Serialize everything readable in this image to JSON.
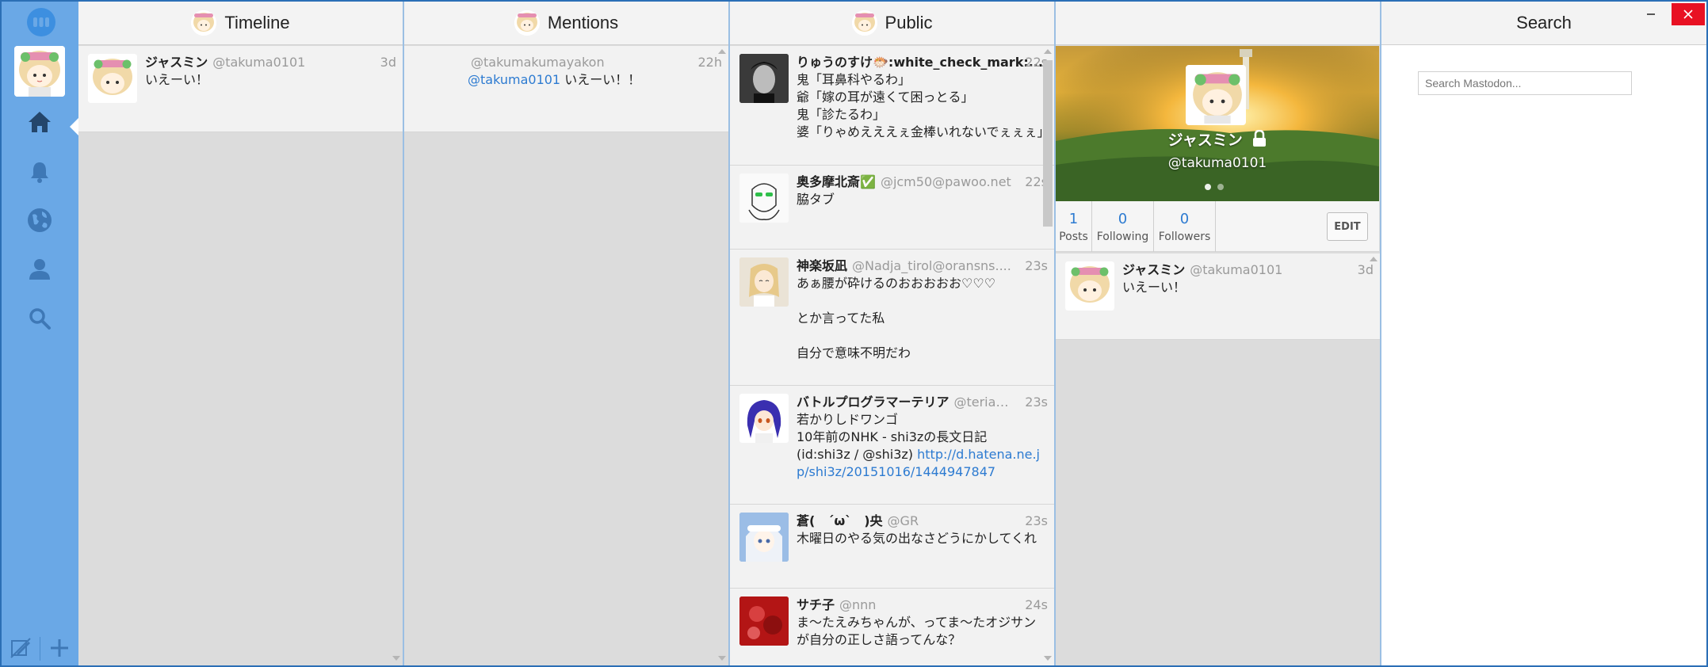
{
  "sidebar": {
    "nav": [
      "home-icon",
      "bell-icon",
      "globe-icon",
      "user-icon",
      "search-icon"
    ],
    "bottom": [
      "edit-icon",
      "plus-icon"
    ]
  },
  "columns": {
    "timeline": {
      "title": "Timeline",
      "toots": [
        {
          "name": "ジャスミン",
          "acct": "@takuma0101",
          "time": "3d",
          "text": "いえーい！"
        }
      ]
    },
    "mentions": {
      "title": "Mentions",
      "toots": [
        {
          "acct": "@takumakumayakon",
          "time": "22h",
          "mention": "@takuma0101",
          "text": " いえーい！！"
        }
      ]
    },
    "public": {
      "title": "Public",
      "toots": [
        {
          "name": "りゅうのすけ🐡:white_check_mark:...",
          "acct": "",
          "time": "22s",
          "text": "鬼「耳鼻科やるわ」\n爺「嫁の耳が遠くて困っとる」\n鬼「診たるわ」\n婆「りゃめえええぇ金棒いれないでぇぇぇ」"
        },
        {
          "name": "奥多摩北斎✅",
          "acct": "@jcm50@pawoo.net",
          "time": "22s",
          "text": "脇タブ"
        },
        {
          "name": "神楽坂凪",
          "acct": "@Nadja_tirol@oransns....",
          "time": "23s",
          "text": "あぁ腰が砕けるのおおおおお♡♡♡\n\nとか言ってた私\n\n自分で意味不明だわ"
        },
        {
          "name": "バトルプログラマーテリア",
          "acct": "@teria@frie...",
          "time": "23s",
          "text": "若かりしドワンゴ\n10年前のNHK - shi3zの長文日記\n(id:shi3z / @shi3z) ",
          "link": "http://d.hatena.ne.jp/shi3z/20151016/1444947847"
        },
        {
          "name": "蒼(　´ω`　)央",
          "acct": "@GR",
          "time": "23s",
          "text": "木曜日のやる気の出なさどうにかしてくれ"
        },
        {
          "name": "サチ子",
          "acct": "@nnn",
          "time": "24s",
          "text": "ま〜たえみちゃんが、ってま〜たオジサンが自分の正しさ語ってんな？"
        }
      ]
    },
    "profile": {
      "name": "ジャスミン",
      "acct": "@takuma0101",
      "stats": [
        {
          "num": "1",
          "label": "Posts"
        },
        {
          "num": "0",
          "label": "Following"
        },
        {
          "num": "0",
          "label": "Followers"
        }
      ],
      "edit_label": "EDIT",
      "toots": [
        {
          "name": "ジャスミン",
          "acct": "@takuma0101",
          "time": "3d",
          "text": "いえーい！"
        }
      ]
    },
    "search": {
      "title": "Search",
      "placeholder": "Search Mastodon..."
    }
  },
  "colors": {
    "sidebar": "#6aa8e6",
    "accent": "#2d7bd1",
    "close": "#e81123"
  }
}
